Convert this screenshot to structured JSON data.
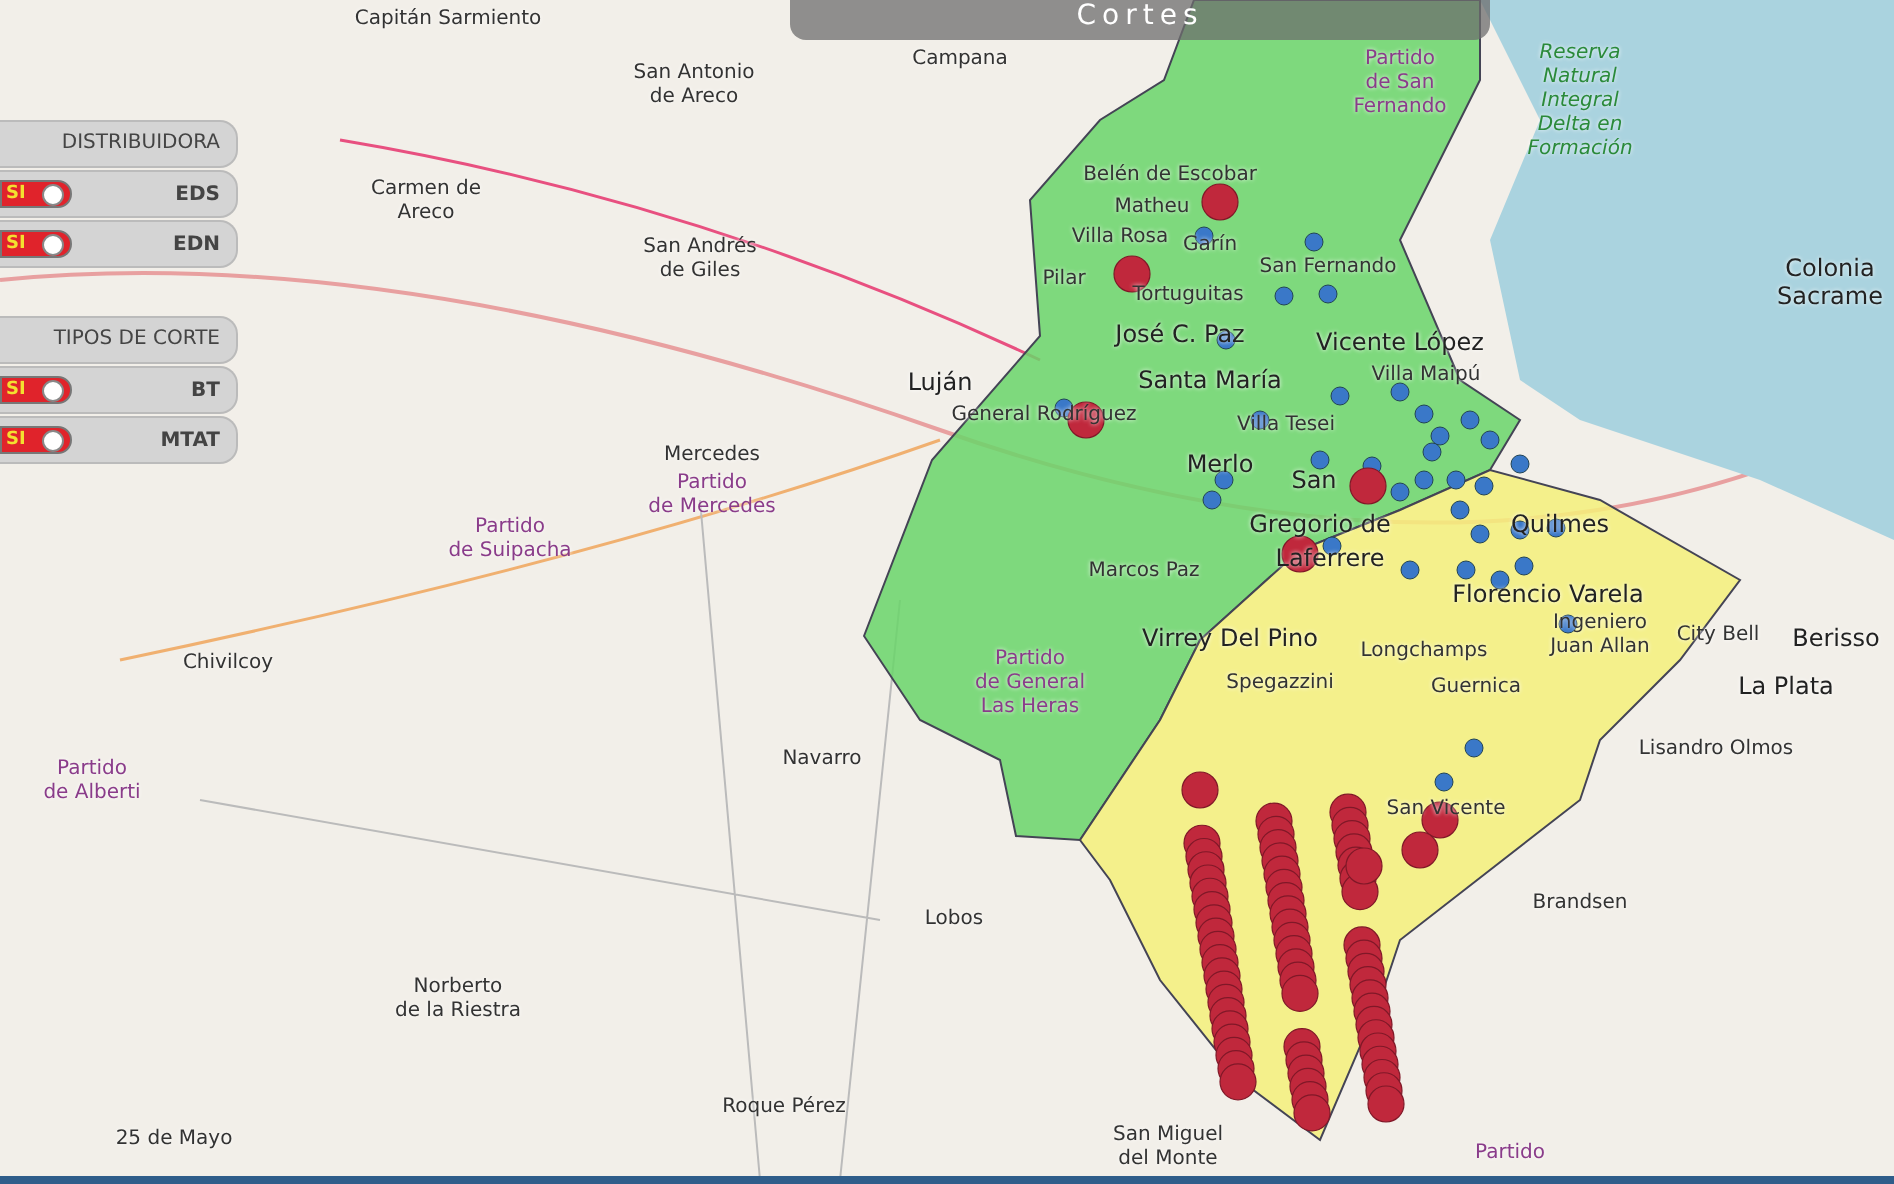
{
  "title": "Cortes",
  "filter_groups": [
    {
      "header": "DISTRIBUIDORA",
      "items": [
        {
          "label": "EDS",
          "toggle_text": "SI",
          "on": true
        },
        {
          "label": "EDN",
          "toggle_text": "SI",
          "on": true
        }
      ]
    },
    {
      "header": "TIPOS DE CORTE",
      "items": [
        {
          "label": "BT",
          "toggle_text": "SI",
          "on": true
        },
        {
          "label": "MTAT",
          "toggle_text": "SI",
          "on": true
        }
      ]
    }
  ],
  "map_labels": [
    {
      "text": "Capitán Sarmiento",
      "kind": "town"
    },
    {
      "text": "San Antonio\nde Areco",
      "kind": "town"
    },
    {
      "text": "Carmen de\nAreco",
      "kind": "town"
    },
    {
      "text": "San Andrés\nde Giles",
      "kind": "town"
    },
    {
      "text": "Luján",
      "kind": "city"
    },
    {
      "text": "Mercedes",
      "kind": "town"
    },
    {
      "text": "Partido\nde Mercedes",
      "kind": "district"
    },
    {
      "text": "Partido\nde Suipacha",
      "kind": "district"
    },
    {
      "text": "Chivilcoy",
      "kind": "town"
    },
    {
      "text": "Partido\nde Alberti",
      "kind": "district"
    },
    {
      "text": "Navarro",
      "kind": "town"
    },
    {
      "text": "Lobos",
      "kind": "town"
    },
    {
      "text": "Norberto\nde la Riestra",
      "kind": "town"
    },
    {
      "text": "25 de Mayo",
      "kind": "town"
    },
    {
      "text": "Roque Pérez",
      "kind": "town"
    },
    {
      "text": "San Miguel\ndel Monte",
      "kind": "town"
    },
    {
      "text": "Partido",
      "kind": "district"
    },
    {
      "text": "City Bell",
      "kind": "town"
    },
    {
      "text": "Berisso",
      "kind": "city"
    },
    {
      "text": "La Plata",
      "kind": "city"
    },
    {
      "text": "Lisandro Olmos",
      "kind": "town"
    },
    {
      "text": "Brandsen",
      "kind": "town"
    },
    {
      "text": "Colonia\nSacrame",
      "kind": "city"
    },
    {
      "text": "Campana",
      "kind": "town"
    },
    {
      "text": "Partido\nde San\nFernando",
      "kind": "district"
    },
    {
      "text": "Reserva\nNatural\nIntegral\nDelta en\nFormación",
      "kind": "park"
    },
    {
      "text": "Belén de Escobar",
      "kind": "town"
    },
    {
      "text": "Matheu",
      "kind": "town"
    },
    {
      "text": "Villa Rosa",
      "kind": "town"
    },
    {
      "text": "Garín",
      "kind": "town"
    },
    {
      "text": "Pilar",
      "kind": "town"
    },
    {
      "text": "Tortuguitas",
      "kind": "town"
    },
    {
      "text": "San Fernando",
      "kind": "town"
    },
    {
      "text": "José C. Paz",
      "kind": "city"
    },
    {
      "text": "Vicente López",
      "kind": "city"
    },
    {
      "text": "Santa María",
      "kind": "city"
    },
    {
      "text": "Villa Maipú",
      "kind": "town"
    },
    {
      "text": "General Rodríguez",
      "kind": "town"
    },
    {
      "text": "Villa Tesei",
      "kind": "town"
    },
    {
      "text": "Merlo",
      "kind": "city"
    },
    {
      "text": "San",
      "kind": "city"
    },
    {
      "text": "Gregorio de",
      "kind": "city"
    },
    {
      "text": "Laferrere",
      "kind": "city"
    },
    {
      "text": "Marcos Paz",
      "kind": "town"
    },
    {
      "text": "Partido\nde General\nLas Heras",
      "kind": "district"
    },
    {
      "text": "Virrey Del Pino",
      "kind": "city"
    },
    {
      "text": "Quilmes",
      "kind": "city"
    },
    {
      "text": "Florencio Varela",
      "kind": "city"
    },
    {
      "text": "Longchamps",
      "kind": "town"
    },
    {
      "text": "Ingeniero\nJuan Allan",
      "kind": "town"
    },
    {
      "text": "Spegazzini",
      "kind": "town"
    },
    {
      "text": "Guernica",
      "kind": "town"
    },
    {
      "text": "San Vicente",
      "kind": "town"
    }
  ]
}
